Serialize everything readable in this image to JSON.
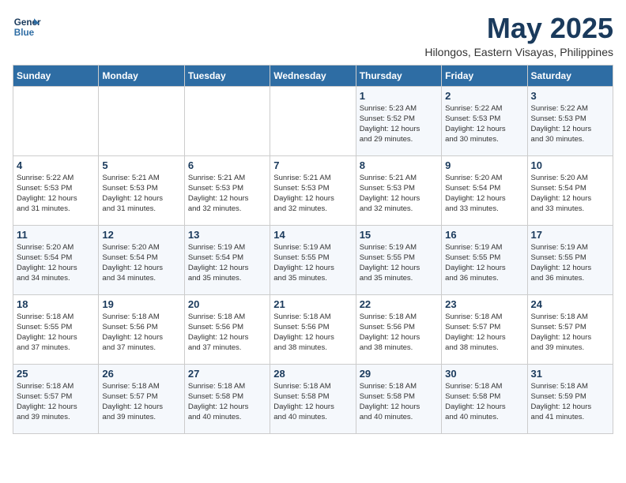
{
  "logo": {
    "line1": "General",
    "line2": "Blue"
  },
  "title": "May 2025",
  "subtitle": "Hilongos, Eastern Visayas, Philippines",
  "days_of_week": [
    "Sunday",
    "Monday",
    "Tuesday",
    "Wednesday",
    "Thursday",
    "Friday",
    "Saturday"
  ],
  "weeks": [
    [
      {
        "day": "",
        "info": ""
      },
      {
        "day": "",
        "info": ""
      },
      {
        "day": "",
        "info": ""
      },
      {
        "day": "",
        "info": ""
      },
      {
        "day": "1",
        "info": "Sunrise: 5:23 AM\nSunset: 5:52 PM\nDaylight: 12 hours\nand 29 minutes."
      },
      {
        "day": "2",
        "info": "Sunrise: 5:22 AM\nSunset: 5:53 PM\nDaylight: 12 hours\nand 30 minutes."
      },
      {
        "day": "3",
        "info": "Sunrise: 5:22 AM\nSunset: 5:53 PM\nDaylight: 12 hours\nand 30 minutes."
      }
    ],
    [
      {
        "day": "4",
        "info": "Sunrise: 5:22 AM\nSunset: 5:53 PM\nDaylight: 12 hours\nand 31 minutes."
      },
      {
        "day": "5",
        "info": "Sunrise: 5:21 AM\nSunset: 5:53 PM\nDaylight: 12 hours\nand 31 minutes."
      },
      {
        "day": "6",
        "info": "Sunrise: 5:21 AM\nSunset: 5:53 PM\nDaylight: 12 hours\nand 32 minutes."
      },
      {
        "day": "7",
        "info": "Sunrise: 5:21 AM\nSunset: 5:53 PM\nDaylight: 12 hours\nand 32 minutes."
      },
      {
        "day": "8",
        "info": "Sunrise: 5:21 AM\nSunset: 5:53 PM\nDaylight: 12 hours\nand 32 minutes."
      },
      {
        "day": "9",
        "info": "Sunrise: 5:20 AM\nSunset: 5:54 PM\nDaylight: 12 hours\nand 33 minutes."
      },
      {
        "day": "10",
        "info": "Sunrise: 5:20 AM\nSunset: 5:54 PM\nDaylight: 12 hours\nand 33 minutes."
      }
    ],
    [
      {
        "day": "11",
        "info": "Sunrise: 5:20 AM\nSunset: 5:54 PM\nDaylight: 12 hours\nand 34 minutes."
      },
      {
        "day": "12",
        "info": "Sunrise: 5:20 AM\nSunset: 5:54 PM\nDaylight: 12 hours\nand 34 minutes."
      },
      {
        "day": "13",
        "info": "Sunrise: 5:19 AM\nSunset: 5:54 PM\nDaylight: 12 hours\nand 35 minutes."
      },
      {
        "day": "14",
        "info": "Sunrise: 5:19 AM\nSunset: 5:55 PM\nDaylight: 12 hours\nand 35 minutes."
      },
      {
        "day": "15",
        "info": "Sunrise: 5:19 AM\nSunset: 5:55 PM\nDaylight: 12 hours\nand 35 minutes."
      },
      {
        "day": "16",
        "info": "Sunrise: 5:19 AM\nSunset: 5:55 PM\nDaylight: 12 hours\nand 36 minutes."
      },
      {
        "day": "17",
        "info": "Sunrise: 5:19 AM\nSunset: 5:55 PM\nDaylight: 12 hours\nand 36 minutes."
      }
    ],
    [
      {
        "day": "18",
        "info": "Sunrise: 5:18 AM\nSunset: 5:55 PM\nDaylight: 12 hours\nand 37 minutes."
      },
      {
        "day": "19",
        "info": "Sunrise: 5:18 AM\nSunset: 5:56 PM\nDaylight: 12 hours\nand 37 minutes."
      },
      {
        "day": "20",
        "info": "Sunrise: 5:18 AM\nSunset: 5:56 PM\nDaylight: 12 hours\nand 37 minutes."
      },
      {
        "day": "21",
        "info": "Sunrise: 5:18 AM\nSunset: 5:56 PM\nDaylight: 12 hours\nand 38 minutes."
      },
      {
        "day": "22",
        "info": "Sunrise: 5:18 AM\nSunset: 5:56 PM\nDaylight: 12 hours\nand 38 minutes."
      },
      {
        "day": "23",
        "info": "Sunrise: 5:18 AM\nSunset: 5:57 PM\nDaylight: 12 hours\nand 38 minutes."
      },
      {
        "day": "24",
        "info": "Sunrise: 5:18 AM\nSunset: 5:57 PM\nDaylight: 12 hours\nand 39 minutes."
      }
    ],
    [
      {
        "day": "25",
        "info": "Sunrise: 5:18 AM\nSunset: 5:57 PM\nDaylight: 12 hours\nand 39 minutes."
      },
      {
        "day": "26",
        "info": "Sunrise: 5:18 AM\nSunset: 5:57 PM\nDaylight: 12 hours\nand 39 minutes."
      },
      {
        "day": "27",
        "info": "Sunrise: 5:18 AM\nSunset: 5:58 PM\nDaylight: 12 hours\nand 40 minutes."
      },
      {
        "day": "28",
        "info": "Sunrise: 5:18 AM\nSunset: 5:58 PM\nDaylight: 12 hours\nand 40 minutes."
      },
      {
        "day": "29",
        "info": "Sunrise: 5:18 AM\nSunset: 5:58 PM\nDaylight: 12 hours\nand 40 minutes."
      },
      {
        "day": "30",
        "info": "Sunrise: 5:18 AM\nSunset: 5:58 PM\nDaylight: 12 hours\nand 40 minutes."
      },
      {
        "day": "31",
        "info": "Sunrise: 5:18 AM\nSunset: 5:59 PM\nDaylight: 12 hours\nand 41 minutes."
      }
    ]
  ]
}
